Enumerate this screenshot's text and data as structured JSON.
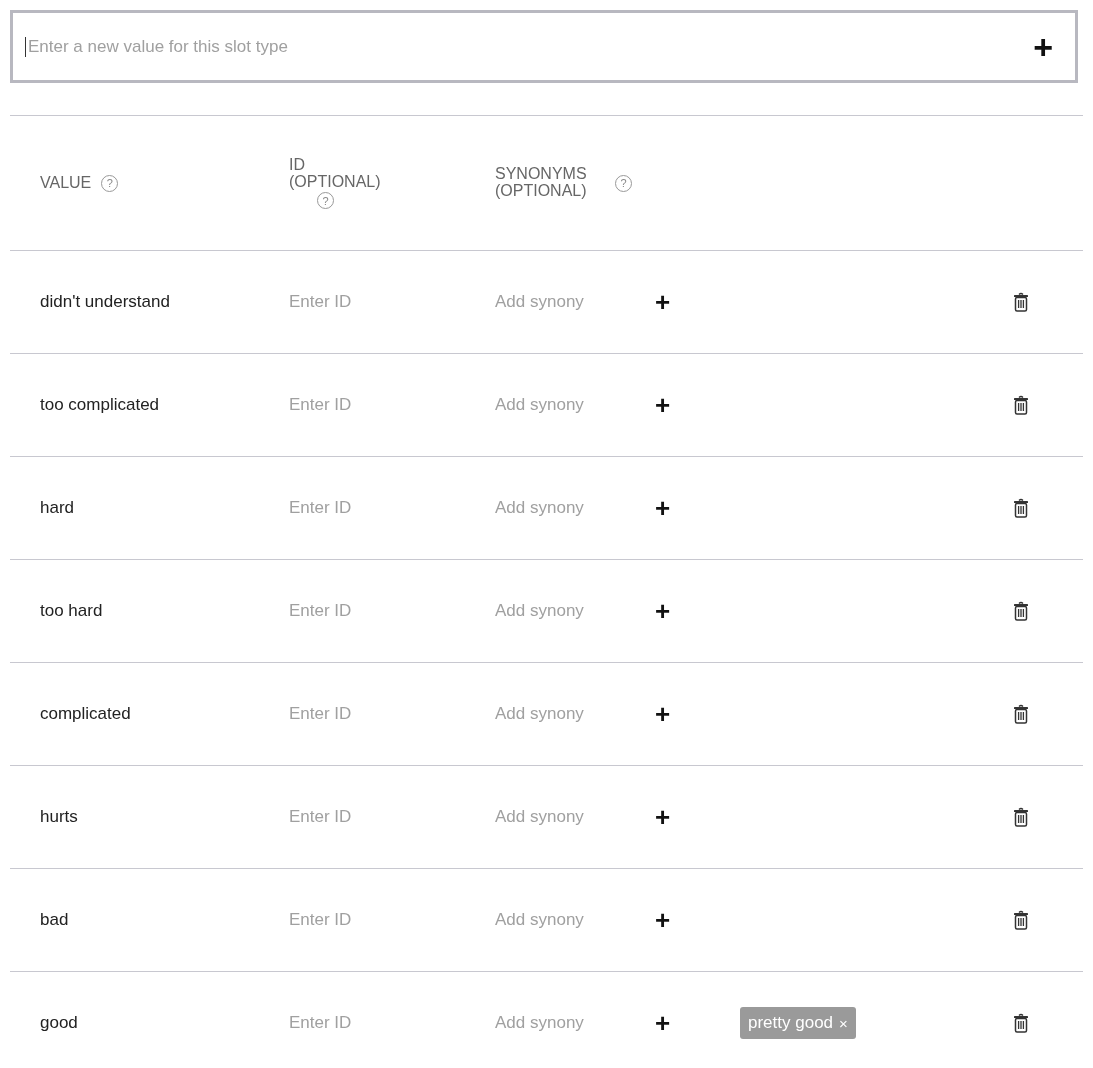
{
  "new_value_field": {
    "placeholder": "Enter a new value for this slot type",
    "add_symbol": "+"
  },
  "table": {
    "columns": [
      {
        "label": "VALUE",
        "help": "?"
      },
      {
        "label": "ID (OPTIONAL)",
        "help": "?"
      },
      {
        "label": "SYNONYMS (OPTIONAL)",
        "help": "?"
      }
    ],
    "rows": [
      {
        "value": "didn't understand",
        "id_placeholder": "Enter ID",
        "synonym_placeholder": "Add synony",
        "add_symbol": "+",
        "synonyms": []
      },
      {
        "value": "too complicated",
        "id_placeholder": "Enter ID",
        "synonym_placeholder": "Add synony",
        "add_symbol": "+",
        "synonyms": []
      },
      {
        "value": "hard",
        "id_placeholder": "Enter ID",
        "synonym_placeholder": "Add synony",
        "add_symbol": "+",
        "synonyms": []
      },
      {
        "value": "too hard",
        "id_placeholder": "Enter ID",
        "synonym_placeholder": "Add synony",
        "add_symbol": "+",
        "synonyms": []
      },
      {
        "value": "complicated",
        "id_placeholder": "Enter ID",
        "synonym_placeholder": "Add synony",
        "add_symbol": "+",
        "synonyms": []
      },
      {
        "value": "hurts",
        "id_placeholder": "Enter ID",
        "synonym_placeholder": "Add synony",
        "add_symbol": "+",
        "synonyms": []
      },
      {
        "value": "bad",
        "id_placeholder": "Enter ID",
        "synonym_placeholder": "Add synony",
        "add_symbol": "+",
        "synonyms": []
      },
      {
        "value": "good",
        "id_placeholder": "Enter ID",
        "synonym_placeholder": "Add synony",
        "add_symbol": "+",
        "synonyms": [
          {
            "label": "pretty good",
            "remove": "×"
          }
        ]
      }
    ]
  }
}
